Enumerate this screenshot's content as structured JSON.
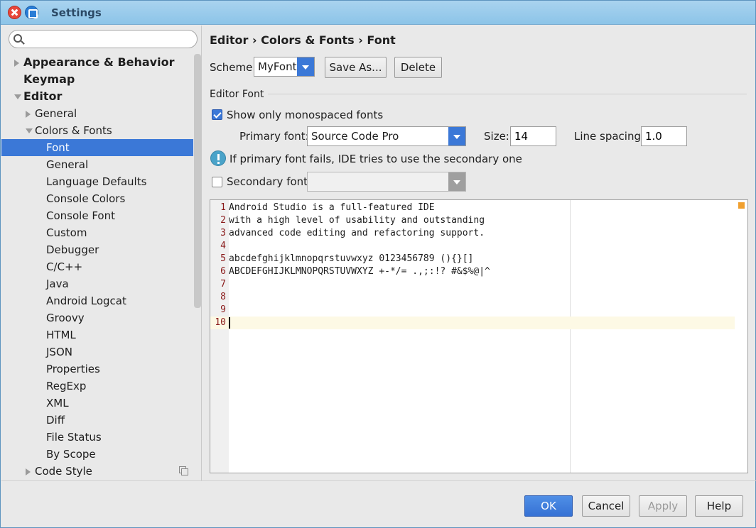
{
  "window": {
    "title": "Settings"
  },
  "search": {
    "value": "",
    "placeholder": ""
  },
  "tree": [
    {
      "label": "Appearance & Behavior",
      "level": 0,
      "bold": true,
      "expander": "right",
      "selected": false
    },
    {
      "label": "Keymap",
      "level": 0,
      "bold": true,
      "expander": "none",
      "selected": false
    },
    {
      "label": "Editor",
      "level": 0,
      "bold": true,
      "expander": "down",
      "selected": false
    },
    {
      "label": "General",
      "level": 1,
      "bold": false,
      "expander": "right",
      "selected": false
    },
    {
      "label": "Colors & Fonts",
      "level": 1,
      "bold": false,
      "expander": "down",
      "selected": false
    },
    {
      "label": "Font",
      "level": 2,
      "bold": false,
      "expander": "none",
      "selected": true
    },
    {
      "label": "General",
      "level": 2,
      "bold": false,
      "expander": "none",
      "selected": false
    },
    {
      "label": "Language Defaults",
      "level": 2,
      "bold": false,
      "expander": "none",
      "selected": false
    },
    {
      "label": "Console Colors",
      "level": 2,
      "bold": false,
      "expander": "none",
      "selected": false
    },
    {
      "label": "Console Font",
      "level": 2,
      "bold": false,
      "expander": "none",
      "selected": false
    },
    {
      "label": "Custom",
      "level": 2,
      "bold": false,
      "expander": "none",
      "selected": false
    },
    {
      "label": "Debugger",
      "level": 2,
      "bold": false,
      "expander": "none",
      "selected": false
    },
    {
      "label": "C/C++",
      "level": 2,
      "bold": false,
      "expander": "none",
      "selected": false
    },
    {
      "label": "Java",
      "level": 2,
      "bold": false,
      "expander": "none",
      "selected": false
    },
    {
      "label": "Android Logcat",
      "level": 2,
      "bold": false,
      "expander": "none",
      "selected": false
    },
    {
      "label": "Groovy",
      "level": 2,
      "bold": false,
      "expander": "none",
      "selected": false
    },
    {
      "label": "HTML",
      "level": 2,
      "bold": false,
      "expander": "none",
      "selected": false
    },
    {
      "label": "JSON",
      "level": 2,
      "bold": false,
      "expander": "none",
      "selected": false
    },
    {
      "label": "Properties",
      "level": 2,
      "bold": false,
      "expander": "none",
      "selected": false
    },
    {
      "label": "RegExp",
      "level": 2,
      "bold": false,
      "expander": "none",
      "selected": false
    },
    {
      "label": "XML",
      "level": 2,
      "bold": false,
      "expander": "none",
      "selected": false
    },
    {
      "label": "Diff",
      "level": 2,
      "bold": false,
      "expander": "none",
      "selected": false
    },
    {
      "label": "File Status",
      "level": 2,
      "bold": false,
      "expander": "none",
      "selected": false
    },
    {
      "label": "By Scope",
      "level": 2,
      "bold": false,
      "expander": "none",
      "selected": false
    },
    {
      "label": "Code Style",
      "level": 1,
      "bold": false,
      "expander": "right",
      "selected": false
    }
  ],
  "breadcrumb": "Editor › Colors & Fonts › Font",
  "scheme": {
    "label": "Scheme:",
    "value": "MyFont",
    "save_as": "Save As...",
    "delete": "Delete"
  },
  "editor_font": {
    "section_title": "Editor Font",
    "show_mono_label": "Show only monospaced fonts",
    "show_mono_checked": true,
    "primary_label": "Primary font:",
    "primary_value": "Source Code Pro",
    "size_label": "Size:",
    "size_value": "14",
    "spacing_label": "Line spacing:",
    "spacing_value": "1.0",
    "info_text": "If primary font fails, IDE tries to use the secondary one",
    "secondary_label": "Secondary font:",
    "secondary_checked": false,
    "secondary_value": ""
  },
  "preview_lines": [
    {
      "num": "1",
      "text": "Android Studio is a full-featured IDE"
    },
    {
      "num": "2",
      "text": "with a high level of usability and outstanding"
    },
    {
      "num": "3",
      "text": "advanced code editing and refactoring support."
    },
    {
      "num": "4",
      "text": ""
    },
    {
      "num": "5",
      "text": "abcdefghijklmnopqrstuvwxyz 0123456789 (){}[]"
    },
    {
      "num": "6",
      "text": "ABCDEFGHIJKLMNOPQRSTUVWXYZ +-*/= .,;:!? #&$%@|^"
    },
    {
      "num": "7",
      "text": ""
    },
    {
      "num": "8",
      "text": ""
    },
    {
      "num": "9",
      "text": ""
    },
    {
      "num": "10",
      "text": ""
    }
  ],
  "current_line": 10,
  "footer": {
    "ok": "OK",
    "cancel": "Cancel",
    "apply": "Apply",
    "help": "Help"
  },
  "colors": {
    "selection": "#3b78d7",
    "accent": "#3b78d7",
    "line_number": "#8a1a1a",
    "marker": "#f0a030"
  }
}
